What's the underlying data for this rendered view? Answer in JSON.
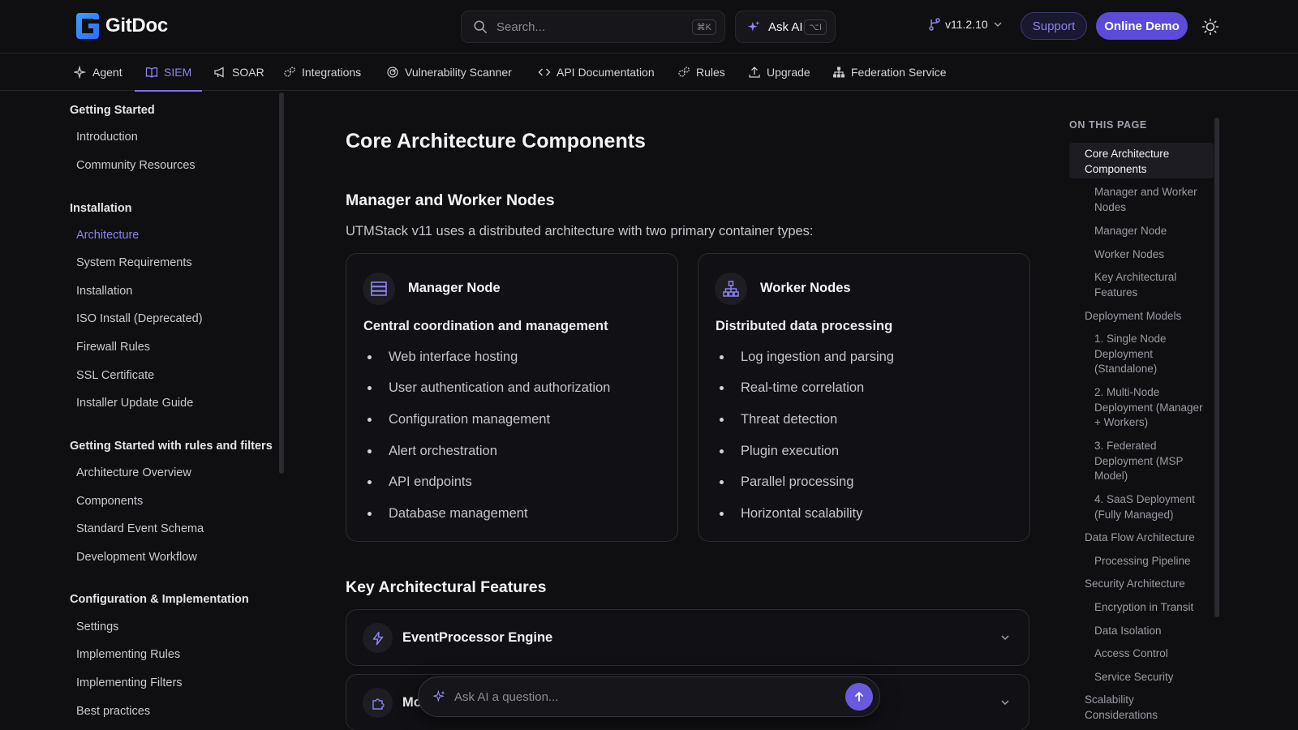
{
  "header": {
    "logo_text": "GitDoc",
    "search_placeholder": "Search...",
    "search_shortcut": "⌘K",
    "ask_ai_label": "Ask AI",
    "ask_ai_shortcut": "⌥I",
    "version": "v11.2.10",
    "support_label": "Support",
    "demo_label": "Online Demo"
  },
  "tabs": [
    {
      "label": "Agent",
      "icon": "sparkle-icon"
    },
    {
      "label": "SIEM",
      "icon": "book-icon",
      "active": true
    },
    {
      "label": "SOAR",
      "icon": "megaphone-icon"
    },
    {
      "label": "Integrations",
      "icon": "gears-icon"
    },
    {
      "label": "Vulnerability Scanner",
      "icon": "radar-icon"
    },
    {
      "label": "API Documentation",
      "icon": "code-icon"
    },
    {
      "label": "Rules",
      "icon": "gears-icon"
    },
    {
      "label": "Upgrade",
      "icon": "upload-icon"
    },
    {
      "label": "Federation Service",
      "icon": "network-icon"
    }
  ],
  "sidebar": {
    "groups": [
      {
        "title": "Getting Started",
        "items": [
          "Introduction",
          "Community Resources"
        ]
      },
      {
        "title": "Installation",
        "items": [
          "Architecture",
          "System Requirements",
          "Installation",
          "ISO Install (Deprecated)",
          "Firewall Rules",
          "SSL Certificate",
          "Installer Update Guide"
        ]
      },
      {
        "title": "Getting Started with rules and filters",
        "items": [
          "Architecture Overview",
          "Components",
          "Standard Event Schema",
          "Development Workflow"
        ]
      },
      {
        "title": "Configuration & Implementation",
        "items": [
          "Settings",
          "Implementing Rules",
          "Implementing Filters",
          "Best practices"
        ]
      }
    ],
    "active_item": "Architecture"
  },
  "main": {
    "title": "Core Architecture Components",
    "section1_title": "Manager and Worker Nodes",
    "intro": "UTMStack v11 uses a distributed architecture with two primary container types:",
    "cards": [
      {
        "title": "Manager Node",
        "icon": "server-stack-icon",
        "subtitle": "Central coordination and management",
        "items": [
          "Web interface hosting",
          "User authentication and authorization",
          "Configuration management",
          "Alert orchestration",
          "API endpoints",
          "Database management"
        ]
      },
      {
        "title": "Worker Nodes",
        "icon": "node-tree-icon",
        "subtitle": "Distributed data processing",
        "items": [
          "Log ingestion and parsing",
          "Real-time correlation",
          "Threat detection",
          "Plugin execution",
          "Parallel processing",
          "Horizontal scalability"
        ]
      }
    ],
    "section2_title": "Key Architectural Features",
    "accordions": [
      {
        "title": "EventProcessor Engine",
        "icon": "lightning-icon"
      },
      {
        "title": "Mo",
        "icon": "puzzle-icon"
      }
    ]
  },
  "ask_bar": {
    "placeholder": "Ask AI a question..."
  },
  "toc": {
    "heading": "ON THIS PAGE",
    "items": [
      {
        "label": "Core Architecture Components",
        "level": 1,
        "active": true
      },
      {
        "label": "Manager and Worker Nodes",
        "level": 2
      },
      {
        "label": "Manager Node",
        "level": 2
      },
      {
        "label": "Worker Nodes",
        "level": 2
      },
      {
        "label": "Key Architectural Features",
        "level": 2
      },
      {
        "label": "Deployment Models",
        "level": 1
      },
      {
        "label": "1. Single Node Deployment (Standalone)",
        "level": 2
      },
      {
        "label": "2. Multi-Node Deployment (Manager + Workers)",
        "level": 2
      },
      {
        "label": "3. Federated Deployment (MSP Model)",
        "level": 2
      },
      {
        "label": "4. SaaS Deployment (Fully Managed)",
        "level": 2
      },
      {
        "label": "Data Flow Architecture",
        "level": 1
      },
      {
        "label": "Processing Pipeline",
        "level": 2
      },
      {
        "label": "Security Architecture",
        "level": 1
      },
      {
        "label": "Encryption in Transit",
        "level": 2
      },
      {
        "label": "Data Isolation",
        "level": 2
      },
      {
        "label": "Access Control",
        "level": 2
      },
      {
        "label": "Service Security",
        "level": 2
      },
      {
        "label": "Scalability Considerations",
        "level": 1
      }
    ]
  },
  "colors": {
    "accent": "#7b70ee",
    "background": "#0f0f12",
    "demo_button": "#5b4bd8"
  }
}
